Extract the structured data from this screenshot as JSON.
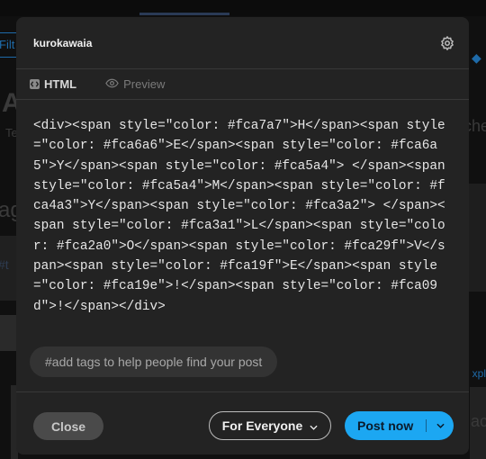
{
  "background": {
    "filter_label": "Filt",
    "left_heading": "A",
    "left_sub": "Te",
    "left_tag": "ag",
    "left_hash": "#t",
    "right_heading": "che",
    "right_link": "xpl",
    "right_label": "ac"
  },
  "post_editor": {
    "username": "kurokawaia",
    "settings_icon": "gear-icon",
    "tabs": [
      {
        "label": "HTML",
        "icon": "html-icon",
        "active": true
      },
      {
        "label": "Preview",
        "icon": "eye-icon",
        "active": false
      }
    ],
    "html_source": "<div><span style=\"color: #fca7a7\">H</span><span style=\"color: #fca6a6\">E</span><span style=\"color: #fca6a5\">Y</span><span style=\"color: #fca5a4\"> </span><span style=\"color: #fca5a4\">M</span><span style=\"color: #fca4a3\">Y</span><span style=\"color: #fca3a2\"> </span><span style=\"color: #fca3a1\">L</span><span style=\"color: #fca2a0\">O</span><span style=\"color: #fca29f\">V</span><span style=\"color: #fca19f\">E</span><span style=\"color: #fca19e\">!</span><span style=\"color: #fca09d\">!</span></div>",
    "tags_placeholder": "#add tags to help people find your post",
    "close_label": "Close",
    "audience_label": "For Everyone",
    "post_label": "Post now"
  },
  "colors": {
    "accent": "#1ca7f2",
    "modal_bg": "#232323",
    "page_bg": "#101010"
  }
}
